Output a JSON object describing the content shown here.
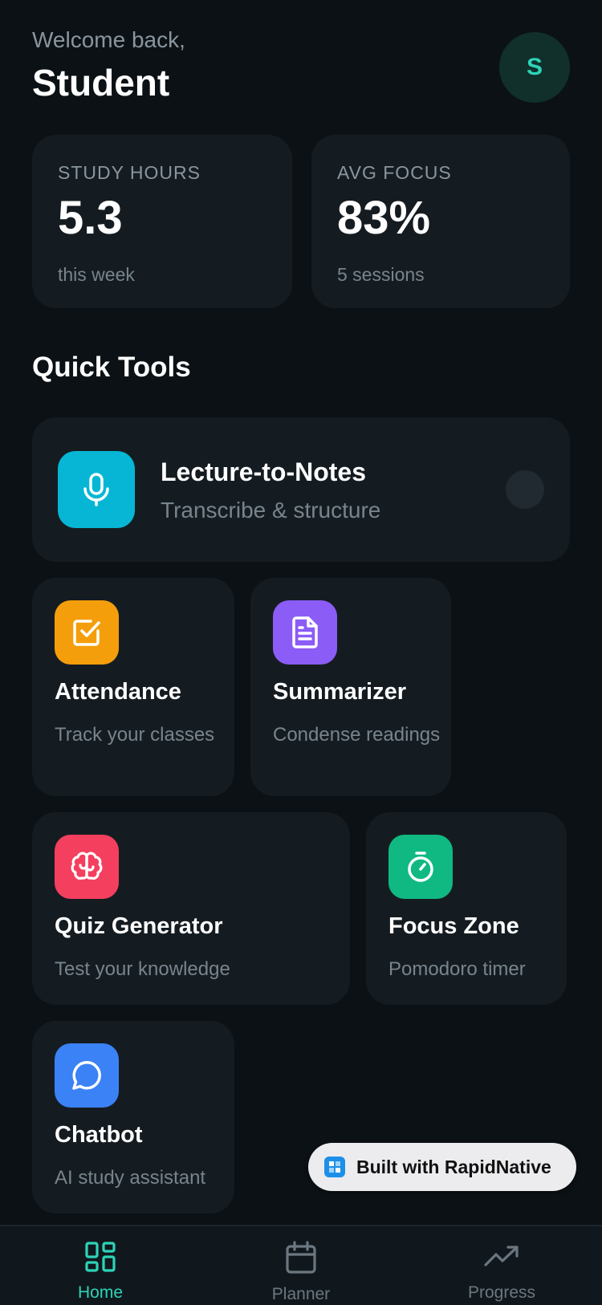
{
  "header": {
    "welcome": "Welcome back,",
    "name": "Student",
    "avatar_initial": "S"
  },
  "stats": [
    {
      "label": "STUDY HOURS",
      "value": "5.3",
      "sub": "this week"
    },
    {
      "label": "AVG FOCUS",
      "value": "83%",
      "sub": "5 sessions"
    }
  ],
  "section_title": "Quick Tools",
  "tools": {
    "lecture": {
      "title": "Lecture-to-Notes",
      "subtitle": "Transcribe & structure",
      "color": "#06b6d4",
      "icon": "microphone-icon"
    },
    "attendance": {
      "title": "Attendance",
      "subtitle": "Track your classes",
      "color": "#f59e0b",
      "icon": "checkbox-icon"
    },
    "summarizer": {
      "title": "Summarizer",
      "subtitle": "Condense readings",
      "color": "#8b5cf6",
      "icon": "document-icon"
    },
    "quiz": {
      "title": "Quiz Generator",
      "subtitle": "Test your knowledge",
      "color": "#f43f5e",
      "icon": "brain-icon"
    },
    "focus": {
      "title": "Focus Zone",
      "subtitle": "Pomodoro timer",
      "color": "#10b981",
      "icon": "stopwatch-icon"
    },
    "chatbot": {
      "title": "Chatbot",
      "subtitle": "AI study assistant",
      "color": "#3b82f6",
      "icon": "chat-bubble-icon"
    }
  },
  "badge": {
    "label": "Built with RapidNative"
  },
  "tabs": [
    {
      "label": "Home",
      "active": true,
      "icon": "grid-icon"
    },
    {
      "label": "Planner",
      "active": false,
      "icon": "calendar-icon"
    },
    {
      "label": "Progress",
      "active": false,
      "icon": "trend-up-icon"
    }
  ],
  "colors": {
    "accent": "#2dd4b8",
    "background": "#0b1115",
    "card": "#151c21"
  }
}
